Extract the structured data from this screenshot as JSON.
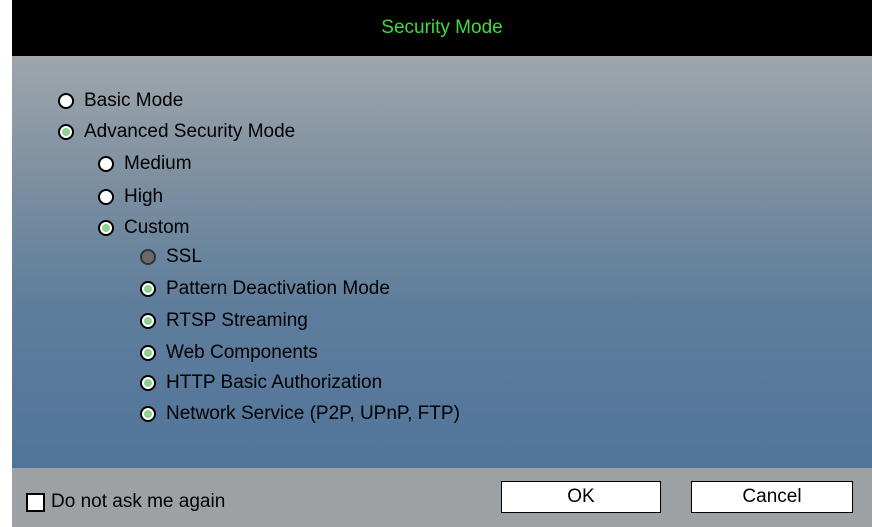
{
  "dialog": {
    "title": "Security Mode",
    "colors": {
      "title_text": "#3fdc3f",
      "title_bg": "#000000",
      "checked_dot": "#8fd18f"
    }
  },
  "options": {
    "basic_mode": {
      "label": "Basic Mode",
      "state": "unchecked"
    },
    "advanced_mode": {
      "label": "Advanced Security Mode",
      "state": "checked"
    },
    "medium": {
      "label": "Medium",
      "state": "unchecked"
    },
    "high": {
      "label": "High",
      "state": "unchecked"
    },
    "custom": {
      "label": "Custom",
      "state": "checked"
    },
    "ssl": {
      "label": "SSL",
      "state": "disabled"
    },
    "pattern_deactivation": {
      "label": "Pattern Deactivation Mode",
      "state": "checked"
    },
    "rtsp_streaming": {
      "label": "RTSP Streaming",
      "state": "checked"
    },
    "web_components": {
      "label": "Web Components",
      "state": "checked"
    },
    "http_basic_auth": {
      "label": "HTTP Basic Authorization",
      "state": "checked"
    },
    "network_service": {
      "label": "Network Service (P2P, UPnP, FTP)",
      "state": "checked"
    }
  },
  "footer": {
    "dont_ask_label": "Do not ask me again",
    "dont_ask_checked": false,
    "ok_label": "OK",
    "cancel_label": "Cancel"
  }
}
